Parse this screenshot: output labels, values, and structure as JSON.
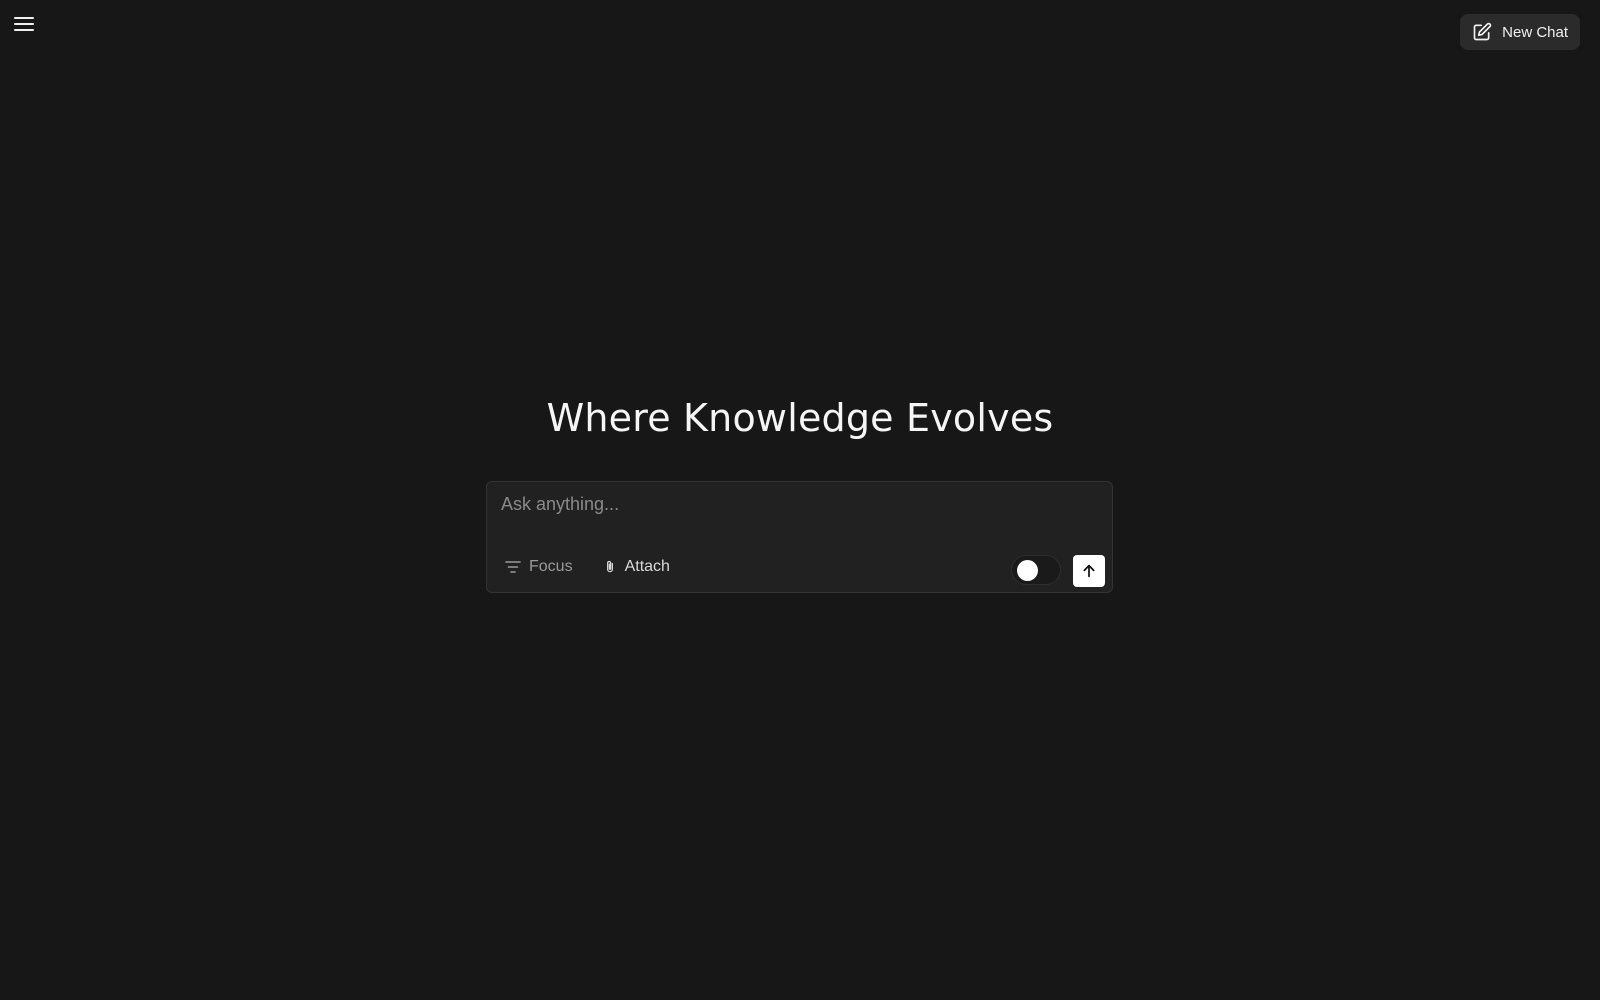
{
  "header": {
    "menu_icon": "hamburger-menu-icon",
    "new_chat_label": "New Chat",
    "new_chat_icon": "edit-square-icon"
  },
  "hero": {
    "title": "Where Knowledge Evolves"
  },
  "composer": {
    "placeholder": "Ask anything...",
    "value": "",
    "focus_label": "Focus",
    "focus_icon": "filter-lines-icon",
    "attach_label": "Attach",
    "attach_icon": "paperclip-icon",
    "toggle_on": false,
    "send_icon": "arrow-up-icon"
  },
  "colors": {
    "background": "#171717",
    "composer_bg": "#212121",
    "button_bg": "#2b2b2b",
    "accent": "#ffffff"
  }
}
